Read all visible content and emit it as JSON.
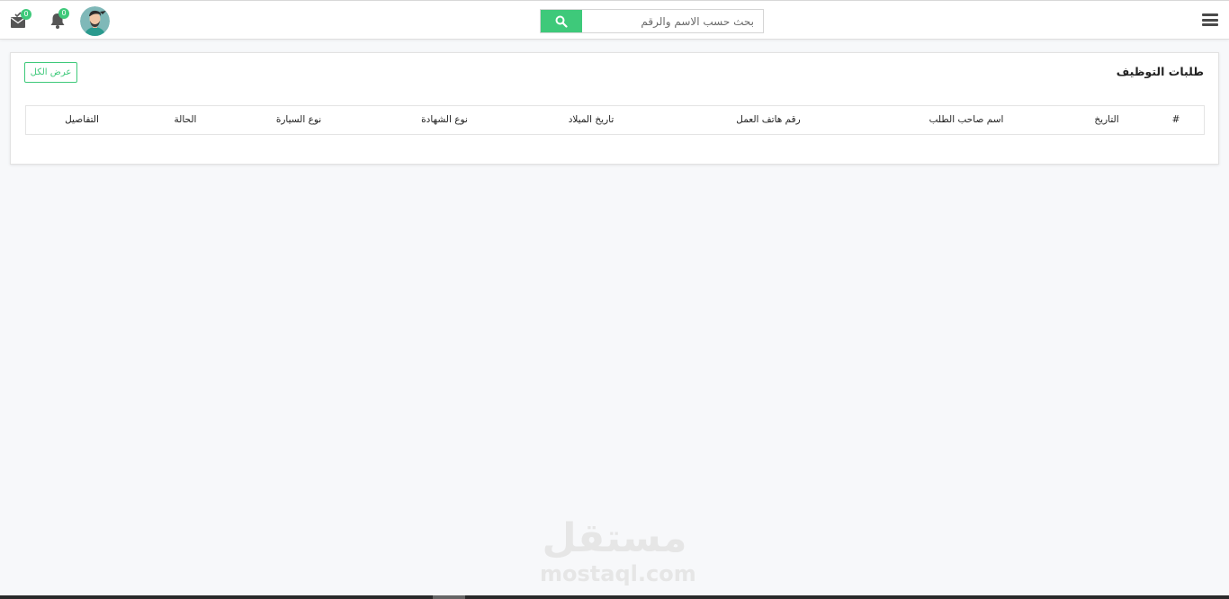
{
  "header": {
    "search": {
      "placeholder": "بحث حسب الاسم والرقم",
      "value": ""
    },
    "notifications": {
      "count": "0"
    },
    "messages": {
      "count": "0"
    },
    "icons": {
      "menu": "hamburger-icon",
      "search": "magnifier-icon",
      "notifications": "bell-icon",
      "messages": "envelope-check-icon",
      "avatar": "user-avatar"
    }
  },
  "card": {
    "title": "طلبات التوظيف",
    "view_all_label": "عرض الكل",
    "table": {
      "columns": [
        "#",
        "التاريخ",
        "اسم صاحب الطلب",
        "رقم هاتف العمل",
        "تاريخ الميلاد",
        "نوع الشهادة",
        "نوع السيارة",
        "الحالة",
        "التفاصيل"
      ],
      "rows": []
    }
  },
  "watermark": {
    "arabic": "مستقل",
    "latin": "mostaql.com"
  },
  "colors": {
    "accent": "#3ec97a",
    "background": "#f7f8fa",
    "surface": "#ffffff"
  }
}
